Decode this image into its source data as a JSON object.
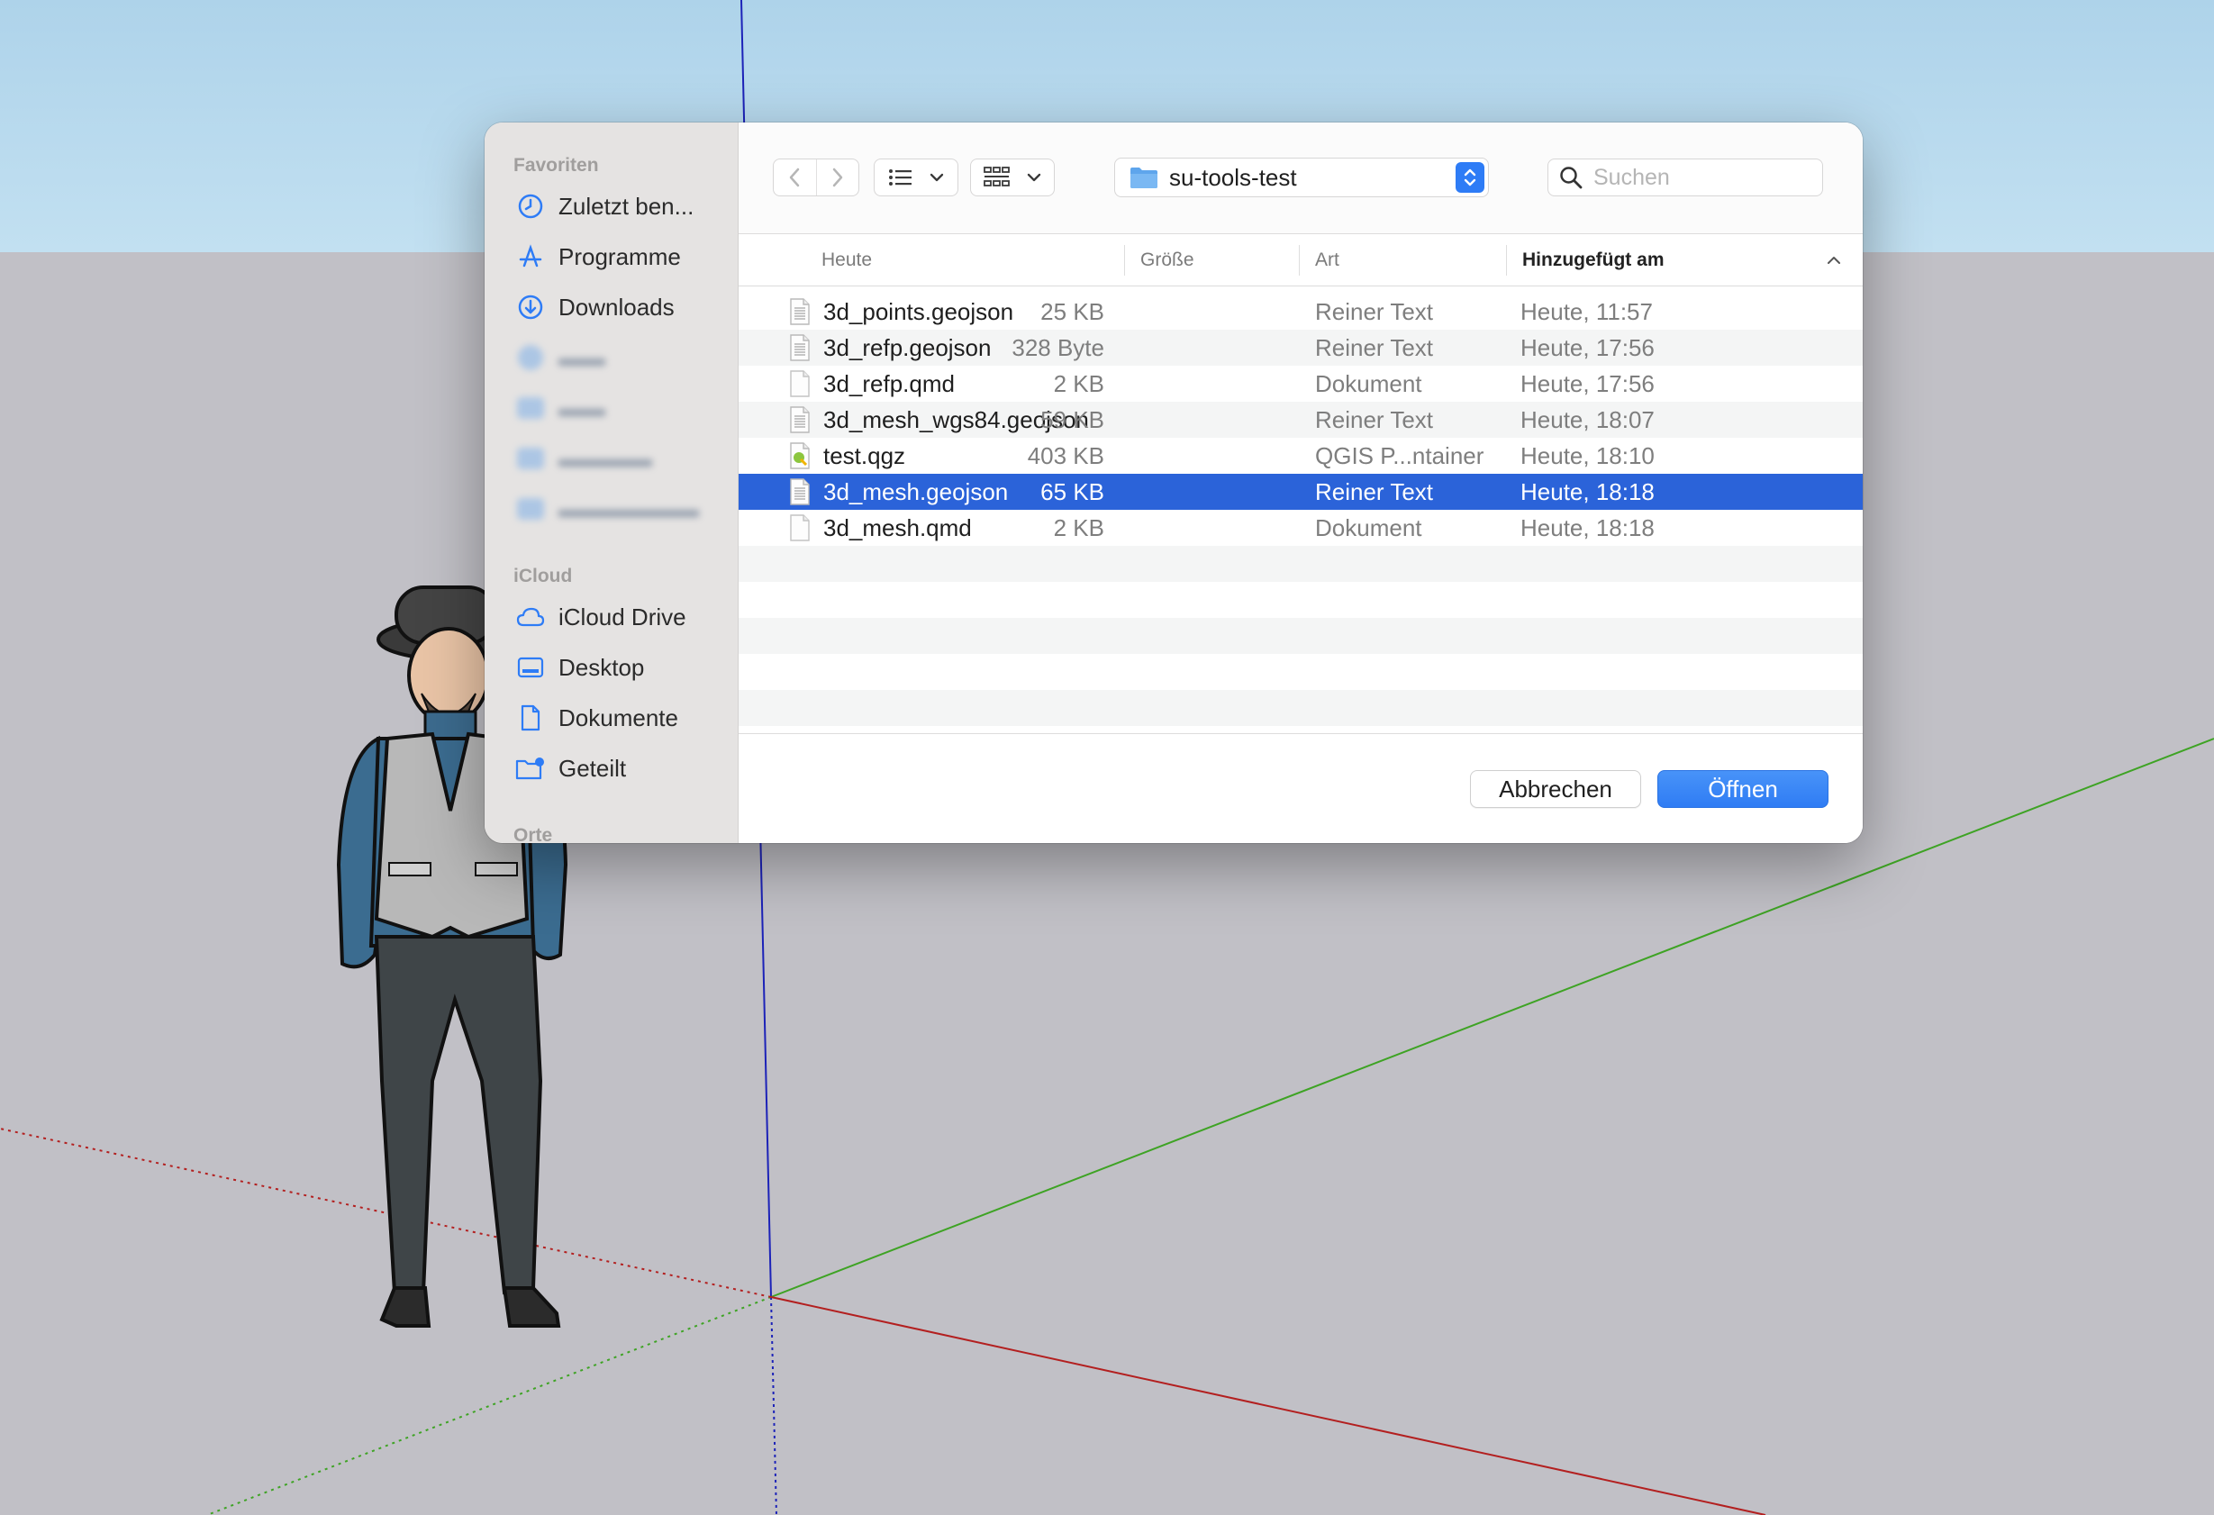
{
  "colors": {
    "accent": "#2e7cf6",
    "selection": "#2b63d9",
    "sidebar_bg": "#e5e3e2",
    "sky": "#b4d8ee",
    "ground": "#c1c0c6"
  },
  "sidebar": {
    "sections": [
      {
        "title": "Favoriten"
      },
      {
        "title": "iCloud"
      },
      {
        "title": "Orte"
      }
    ],
    "favorites": [
      {
        "label": "Zuletzt ben...",
        "icon": "clock-icon"
      },
      {
        "label": "Programme",
        "icon": "apps-icon"
      },
      {
        "label": "Downloads",
        "icon": "download-icon"
      }
    ],
    "icloud": [
      {
        "label": "iCloud Drive",
        "icon": "cloud-icon"
      },
      {
        "label": "Desktop",
        "icon": "desktop-icon"
      },
      {
        "label": "Dokumente",
        "icon": "document-icon"
      },
      {
        "label": "Geteilt",
        "icon": "shared-folder-icon"
      }
    ]
  },
  "toolbar": {
    "location": "su-tools-test",
    "search_placeholder": "Suchen"
  },
  "columns": {
    "name": "Heute",
    "size": "Größe",
    "kind": "Art",
    "added": "Hinzugefügt am"
  },
  "files": [
    {
      "name": "3d_points.geojson",
      "size": "25 KB",
      "kind": "Reiner Text",
      "added": "Heute, 11:57",
      "icon": "text-file-icon"
    },
    {
      "name": "3d_refp.geojson",
      "size": "328 Byte",
      "kind": "Reiner Text",
      "added": "Heute, 17:56",
      "icon": "text-file-icon"
    },
    {
      "name": "3d_refp.qmd",
      "size": "2 KB",
      "kind": "Dokument",
      "added": "Heute, 17:56",
      "icon": "blank-file-icon"
    },
    {
      "name": "3d_mesh_wgs84.geojson",
      "size": "59 KB",
      "kind": "Reiner Text",
      "added": "Heute, 18:07",
      "icon": "text-file-icon"
    },
    {
      "name": "test.qgz",
      "size": "403 KB",
      "kind": "QGIS P...ntainer",
      "added": "Heute, 18:10",
      "icon": "qgis-file-icon"
    },
    {
      "name": "3d_mesh.geojson",
      "size": "65 KB",
      "kind": "Reiner Text",
      "added": "Heute, 18:18",
      "icon": "text-file-icon",
      "selected": true
    },
    {
      "name": "3d_mesh.qmd",
      "size": "2 KB",
      "kind": "Dokument",
      "added": "Heute, 18:18",
      "icon": "blank-file-icon"
    }
  ],
  "footer": {
    "cancel_label": "Abbrechen",
    "open_label": "Öffnen"
  }
}
